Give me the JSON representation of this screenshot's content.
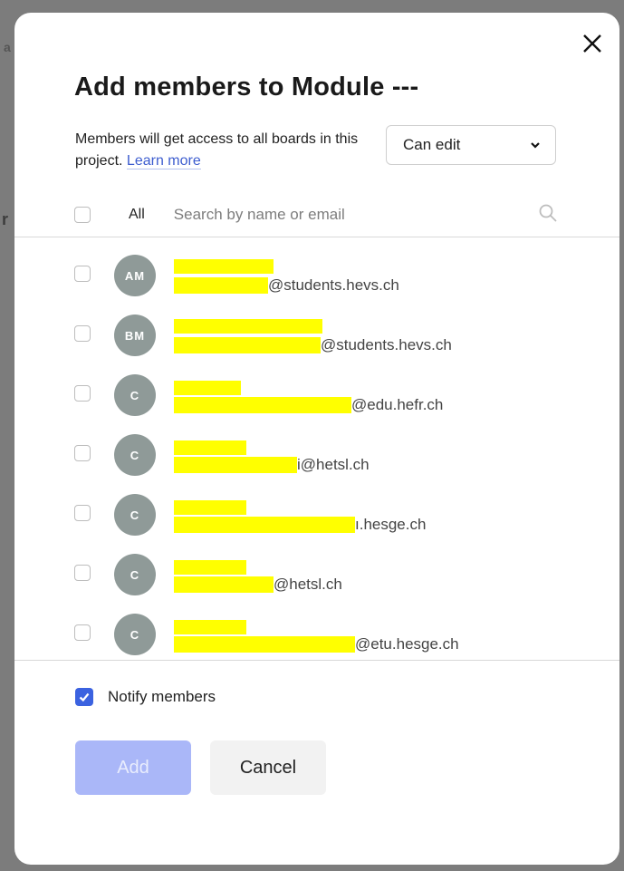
{
  "modal": {
    "title": "Add members to Module ---",
    "description": "Members will get access to all boards in this project.",
    "learn_more": "Learn more",
    "role_select": {
      "value": "Can edit"
    },
    "search": {
      "all_label": "All",
      "placeholder": "Search by name or email"
    },
    "members": [
      {
        "initials": "AM",
        "email_suffix": "@students.hevs.ch"
      },
      {
        "initials": "BM",
        "email_suffix": "@students.hevs.ch"
      },
      {
        "initials": "C",
        "email_suffix": "@edu.hefr.ch"
      },
      {
        "initials": "C",
        "email_suffix": "i@hetsl.ch"
      },
      {
        "initials": "C",
        "email_suffix": "ı.hesge.ch"
      },
      {
        "initials": "C",
        "email_suffix": "@hetsl.ch"
      },
      {
        "initials": "C",
        "email_suffix": "@etu.hesge.ch"
      }
    ],
    "notify": {
      "label": "Notify members",
      "checked": true
    },
    "buttons": {
      "add": "Add",
      "cancel": "Cancel"
    }
  },
  "backdrop": {
    "fragment_1": "a",
    "fragment_2": "r"
  },
  "colors": {
    "accent": "#3b62e0",
    "avatar": "#8f9a98",
    "redaction": "#ffff00",
    "add_disabled": "#aab7f8"
  }
}
